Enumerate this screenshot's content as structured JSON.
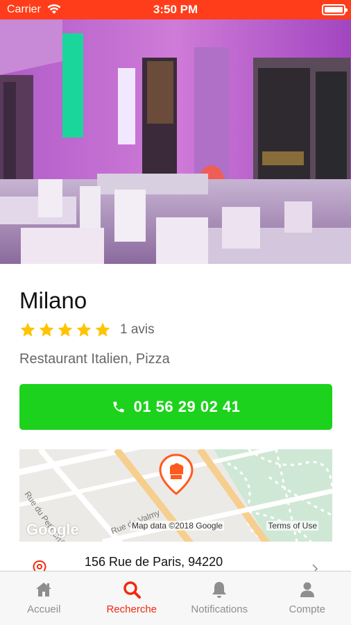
{
  "status_bar": {
    "carrier": "Carrier",
    "time": "3:50 PM"
  },
  "restaurant": {
    "name": "Milano",
    "rating": 5,
    "rating_max": 5,
    "reviews": "1 avis",
    "category": "Restaurant Italien, Pizza",
    "phone": "01 56 29 02 41",
    "address": "156 Rue de Paris, 94220"
  },
  "map": {
    "streets": [
      "Rue du Petit Château",
      "Rue de Valmy"
    ],
    "google_logo": "Google",
    "map_data": "Map data ©2018 Google",
    "terms": "Terms of Use",
    "pin_icon": "chef-hat-icon"
  },
  "tabs": [
    {
      "label": "Accueil",
      "icon": "home-icon",
      "active": false
    },
    {
      "label": "Recherche",
      "icon": "search-icon",
      "active": true
    },
    {
      "label": "Notifications",
      "icon": "bell-icon",
      "active": false
    },
    {
      "label": "Compte",
      "icon": "user-icon",
      "active": false
    }
  ],
  "colors": {
    "status_bar": "#ff3d1a",
    "call_button": "#1dd21d",
    "tab_active": "#f02a10",
    "tab_inactive": "#8e8e8e",
    "star": "#ffc400",
    "map_pin": "#ff5a1f"
  }
}
